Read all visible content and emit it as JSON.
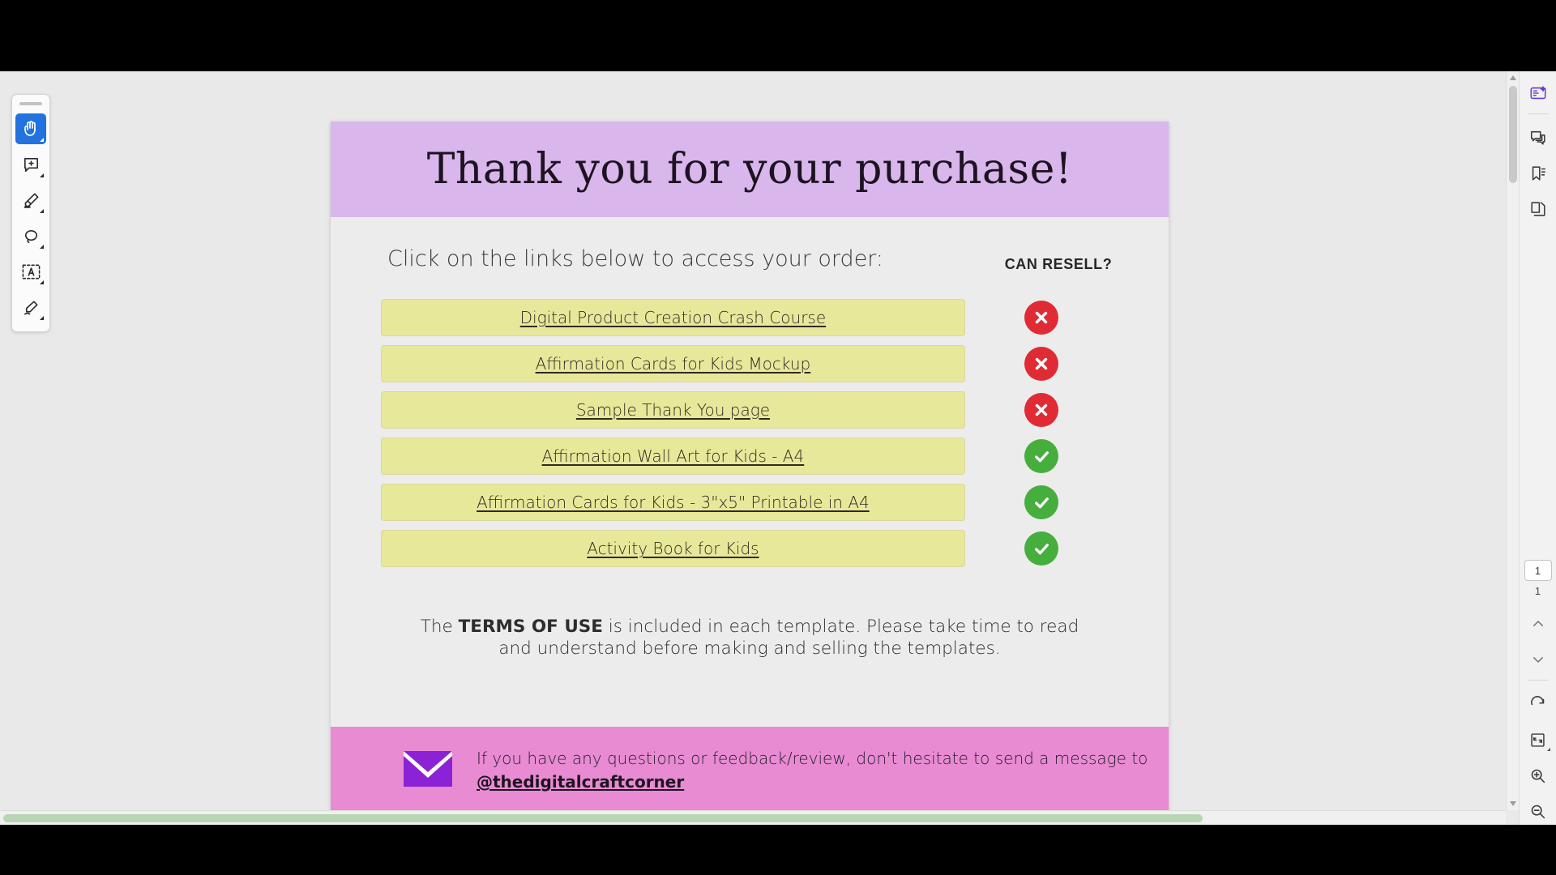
{
  "left_toolbar": {
    "tools": [
      {
        "name": "hand-tool",
        "icon": "hand-icon",
        "active": true
      },
      {
        "name": "comment-tool",
        "icon": "comment-add-icon",
        "active": false
      },
      {
        "name": "highlight-tool",
        "icon": "highlighter-icon",
        "active": false
      },
      {
        "name": "lasso-tool",
        "icon": "lasso-icon",
        "active": false
      },
      {
        "name": "text-select-tool",
        "icon": "text-select-icon",
        "active": false
      },
      {
        "name": "sign-tool",
        "icon": "signature-pen-icon",
        "active": false
      }
    ]
  },
  "document": {
    "title": "Thank you for your purchase!",
    "header_bg": "#d9b6ec",
    "body_bg": "#ececec",
    "footer_bg": "#e88bd2",
    "lead": "Click on the links below to access your order:",
    "resell_column_header": "CAN RESELL?",
    "link_bg": "#e8e89a",
    "yes_color": "#46ae3c",
    "no_color": "#e02b35",
    "links": [
      {
        "label": "Digital Product Creation Crash Course",
        "can_resell": false,
        "status_icon": "x-circle-icon"
      },
      {
        "label": "Affirmation Cards for Kids Mockup",
        "can_resell": false,
        "status_icon": "x-circle-icon"
      },
      {
        "label": "Sample Thank You page",
        "can_resell": false,
        "status_icon": "x-circle-icon"
      },
      {
        "label": "Affirmation Wall Art for Kids - A4",
        "can_resell": true,
        "status_icon": "check-circle-icon"
      },
      {
        "label": "Affirmation Cards for Kids - 3\"x5\" Printable in A4",
        "can_resell": true,
        "status_icon": "check-circle-icon"
      },
      {
        "label": "Activity Book for Kids",
        "can_resell": true,
        "status_icon": "check-circle-icon"
      }
    ],
    "terms": {
      "prefix": "The ",
      "bold": "TERMS OF USE",
      "rest": " is included in each template. Please take time to read and understand before making and selling the templates."
    },
    "footer": {
      "message": "If you have any questions or feedback/review, don't hesitate to send a message to",
      "handle": "@thedigitalcraftcorner",
      "icon": "envelope-icon"
    }
  },
  "right_rail": {
    "top_buttons": [
      {
        "name": "ai-assistant-button",
        "icon": "ai-sparkle-icon"
      },
      {
        "name": "comments-panel-button",
        "icon": "comment-bubbles-icon"
      },
      {
        "name": "bookmarks-panel-button",
        "icon": "bookmark-list-icon"
      },
      {
        "name": "page-thumbnails-button",
        "icon": "copy-pages-icon"
      }
    ],
    "current_page": "1",
    "total_pages": "1",
    "bottom_buttons": [
      {
        "name": "previous-page-button",
        "icon": "chevron-up-icon"
      },
      {
        "name": "next-page-button",
        "icon": "chevron-down-icon"
      },
      {
        "name": "rotate-button",
        "icon": "rotate-cw-icon"
      },
      {
        "name": "fit-page-button",
        "icon": "fit-page-icon"
      },
      {
        "name": "zoom-in-button",
        "icon": "zoom-in-icon"
      },
      {
        "name": "zoom-out-button",
        "icon": "zoom-out-icon"
      }
    ]
  }
}
